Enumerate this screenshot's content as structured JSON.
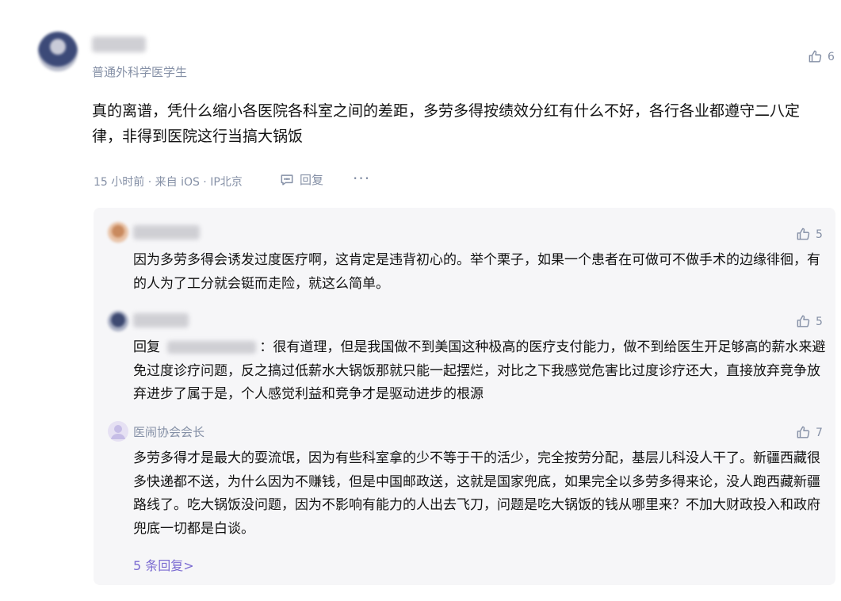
{
  "main_comment": {
    "author_title": "普通外科学医学生",
    "likes": "6",
    "text": "真的离谱，凭什么缩小各医院各科室之间的差距，多劳多得按绩效分红有什么不好，各行各业都遵守二八定律，非得到医院这行当搞大锅饭",
    "meta": "15 小时前 · 来自 iOS · IP北京",
    "reply_label": "回复",
    "more_label": "···"
  },
  "replies": [
    {
      "likes": "5",
      "text": "因为多劳多得会诱发过度医疗啊，这肯定是违背初心的。举个栗子，如果一个患者在可做可不做手术的边缘徘徊，有的人为了工分就会铤而走险，就这么简单。"
    },
    {
      "likes": "5",
      "reply_prefix": "回复",
      "text": "：很有道理，但是我国做不到美国这种极高的医疗支付能力，做不到给医生开足够高的薪水来避免过度诊疗问题，反之搞过低薪水大锅饭那就只能一起摆烂，对比之下我感觉危害比过度诊疗还大，直接放弃竞争放弃进步了属于是，个人感觉利益和竞争才是驱动进步的根源"
    },
    {
      "name": "医闹协会会长",
      "likes": "7",
      "text": "多劳多得才是最大的耍流氓，因为有些科室拿的少不等于干的活少，完全按劳分配，基层儿科没人干了。新疆西藏很多快递都不送，为什么因为不赚钱，但是中国邮政送，这就是国家兜底，如果完全以多劳多得来论，没人跑西藏新疆路线了。吃大锅饭没问题，因为不影响有能力的人出去飞刀，问题是吃大锅饭的钱从哪里来？不加大财政投入和政府兜底一切都是白谈。"
    }
  ],
  "more_replies": "5 条回复>",
  "colors": {
    "muted": "#8590a6",
    "panel_bg": "#f6f6f8",
    "link": "#7b6bd1",
    "text": "#121212"
  }
}
